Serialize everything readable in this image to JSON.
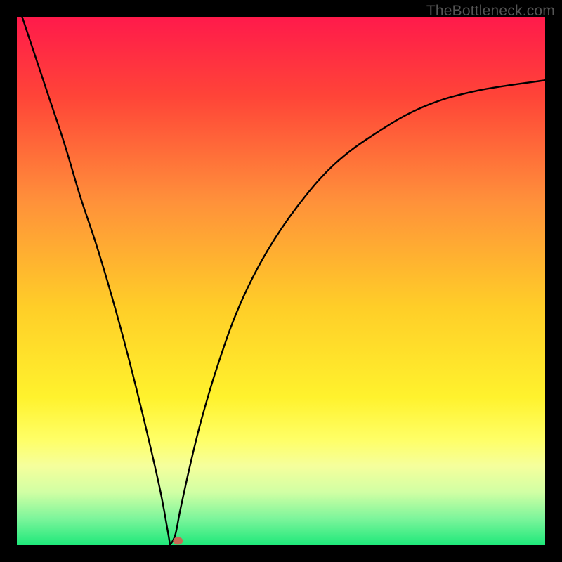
{
  "watermark": "TheBottleneck.com",
  "chart_data": {
    "type": "line",
    "title": "",
    "xlabel": "",
    "ylabel": "",
    "xlim": [
      0,
      100
    ],
    "ylim": [
      0,
      100
    ],
    "curve": {
      "min_x": 29,
      "left": [
        {
          "x": 1,
          "y": 100
        },
        {
          "x": 3,
          "y": 94
        },
        {
          "x": 6,
          "y": 85
        },
        {
          "x": 9,
          "y": 76
        },
        {
          "x": 12,
          "y": 66
        },
        {
          "x": 15,
          "y": 57
        },
        {
          "x": 18,
          "y": 47
        },
        {
          "x": 21,
          "y": 36
        },
        {
          "x": 24,
          "y": 24
        },
        {
          "x": 27,
          "y": 11
        },
        {
          "x": 28.5,
          "y": 3
        },
        {
          "x": 29,
          "y": 0
        }
      ],
      "right": [
        {
          "x": 29,
          "y": 0
        },
        {
          "x": 30,
          "y": 2
        },
        {
          "x": 31,
          "y": 7
        },
        {
          "x": 33,
          "y": 16
        },
        {
          "x": 35,
          "y": 24
        },
        {
          "x": 38,
          "y": 34
        },
        {
          "x": 42,
          "y": 45
        },
        {
          "x": 47,
          "y": 55
        },
        {
          "x": 53,
          "y": 64
        },
        {
          "x": 60,
          "y": 72
        },
        {
          "x": 68,
          "y": 78
        },
        {
          "x": 77,
          "y": 83
        },
        {
          "x": 87,
          "y": 86
        },
        {
          "x": 100,
          "y": 88
        }
      ]
    },
    "marker": {
      "x": 30.5,
      "y": 0.8,
      "color": "#c86a55"
    },
    "gradient_stops": [
      {
        "offset": 0,
        "color": "#ff1a4b"
      },
      {
        "offset": 15,
        "color": "#ff4438"
      },
      {
        "offset": 35,
        "color": "#ff913a"
      },
      {
        "offset": 55,
        "color": "#ffce28"
      },
      {
        "offset": 72,
        "color": "#fff22d"
      },
      {
        "offset": 80,
        "color": "#ffff66"
      },
      {
        "offset": 85,
        "color": "#f5ff9c"
      },
      {
        "offset": 90,
        "color": "#d1ffa4"
      },
      {
        "offset": 95,
        "color": "#7cf59b"
      },
      {
        "offset": 100,
        "color": "#1ee87a"
      }
    ]
  }
}
